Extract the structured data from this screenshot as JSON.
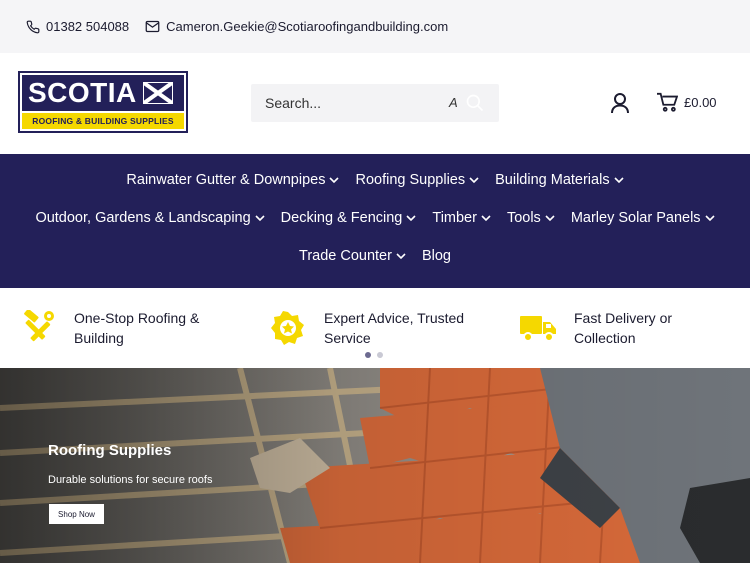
{
  "topbar": {
    "phone": "01382 504088",
    "email": "Cameron.Geekie@Scotiaroofingandbuilding.com"
  },
  "logo": {
    "word": "SCOTIA",
    "tagline": "ROOFING & BUILDING SUPPLIES"
  },
  "search": {
    "placeholder": "Search...",
    "caret": "A"
  },
  "cart": {
    "total": "£0.00"
  },
  "nav": {
    "row1": [
      "Rainwater Gutter & Downpipes",
      "Roofing Supplies",
      "Building Materials"
    ],
    "row2": [
      "Outdoor, Gardens & Landscaping",
      "Decking & Fencing",
      "Timber",
      "Tools",
      "Marley Solar Panels"
    ],
    "row3_dropdown": "Trade Counter",
    "row3_link": "Blog"
  },
  "features": [
    {
      "line1": "One-Stop Roofing &",
      "line2": "Building",
      "icon": "tools-icon"
    },
    {
      "line1": "Expert Advice, Trusted",
      "line2": "Service",
      "icon": "badge-icon"
    },
    {
      "line1": "Fast Delivery or",
      "line2": "Collection",
      "icon": "delivery-truck-icon"
    }
  ],
  "hero": {
    "title": "Roofing Supplies",
    "subtitle": "Durable solutions for secure roofs",
    "button": "Shop Now"
  },
  "colors": {
    "navy": "#232059",
    "yellow": "#f5d800",
    "tile": "#d86a3a"
  }
}
